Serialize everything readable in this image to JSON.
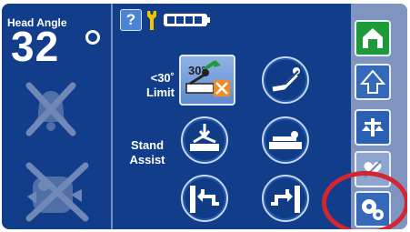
{
  "head_angle": {
    "label": "Head Angle",
    "value": "32",
    "unit_icon": "degree-symbol"
  },
  "top_bar": {
    "help_label": "?",
    "wrench_icon": "wrench-icon",
    "battery_icon": "battery-icon"
  },
  "left_icons": {
    "alarm_icon": "alarm-bell-disabled-icon",
    "fall_icon": "bed-exit-disabled-icon"
  },
  "controls": {
    "limit_label": "<30°\nLimit",
    "limit_button_text": "30°",
    "stand_label": "Stand\nAssist"
  },
  "side_nav": {
    "home_icon": "home-icon",
    "up_icon": "up-arrow-icon",
    "scale_icon": "scale-icon",
    "disabled_icon": "heart-slash-icon",
    "settings_icon": "settings-gears-icon"
  },
  "colors": {
    "panel": "#113d8a",
    "accent_green": "#1f9a3b",
    "highlight_red": "#d42630",
    "button_blue": "#4a84d4"
  }
}
